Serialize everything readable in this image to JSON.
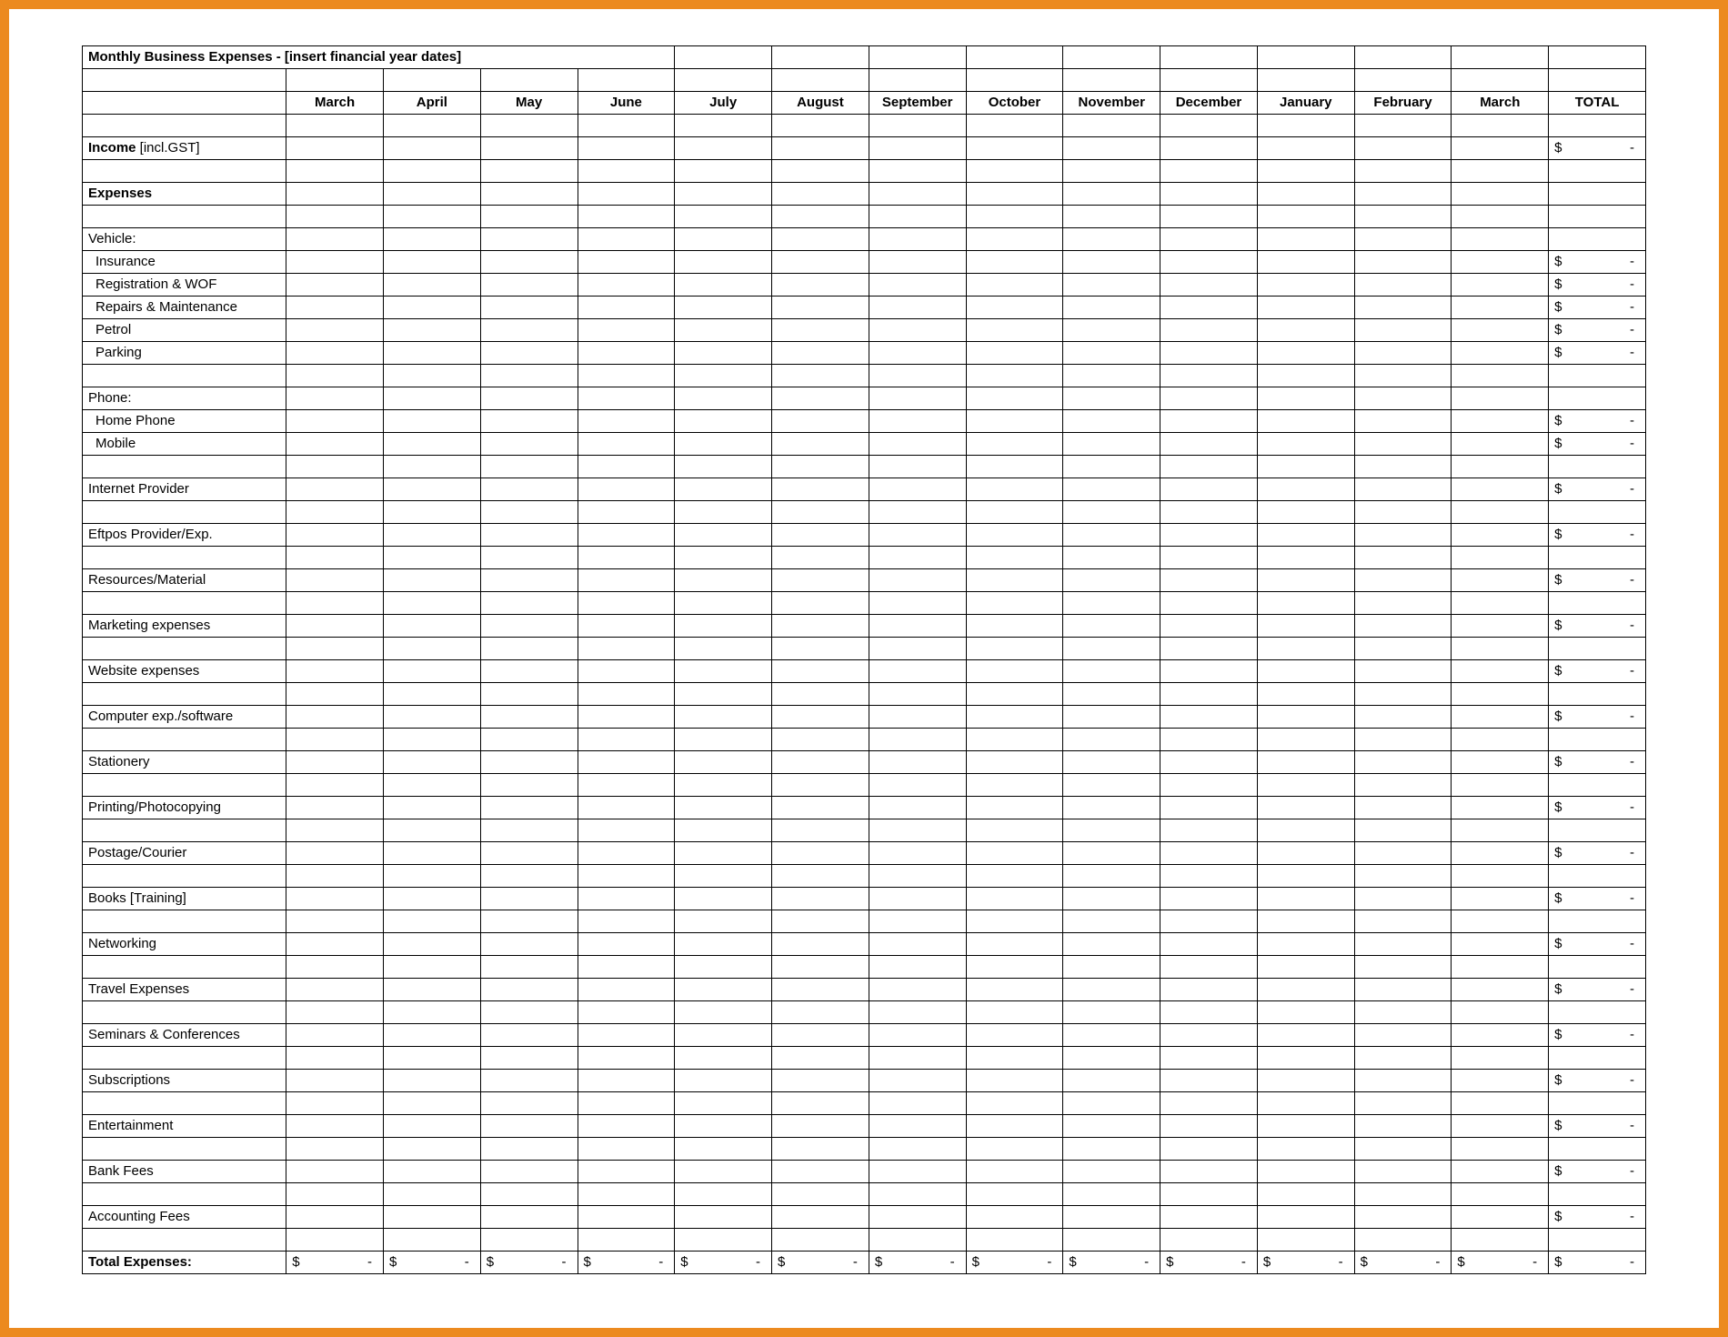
{
  "title": "Monthly Business Expenses - [insert financial year dates]",
  "months": [
    "March",
    "April",
    "May",
    "June",
    "July",
    "August",
    "September",
    "October",
    "November",
    "December",
    "January",
    "February",
    "March"
  ],
  "total_label": "TOTAL",
  "income_label_bold": "Income",
  "income_label_rest": " [incl.GST]",
  "expenses_section_label": "Expenses",
  "vehicle_section_label": "Vehicle:",
  "vehicle_items": [
    "Insurance",
    "Registration & WOF",
    "Repairs & Maintenance",
    "Petrol",
    "Parking"
  ],
  "phone_section_label": "Phone:",
  "phone_items": [
    "Home Phone",
    "Mobile"
  ],
  "standalone_expenses": [
    "Internet Provider",
    "Eftpos Provider/Exp.",
    "Resources/Material",
    "Marketing expenses",
    "Website expenses",
    "Computer exp./software",
    "Stationery",
    "Printing/Photocopying",
    "Postage/Courier",
    "Books [Training]",
    "Networking",
    "Travel Expenses",
    "Seminars & Conferences",
    "Subscriptions",
    "Entertainment",
    "Bank Fees",
    "Accounting Fees"
  ],
  "total_expenses_label": "Total Expenses:",
  "currency_symbol": "$",
  "currency_dash": "-"
}
